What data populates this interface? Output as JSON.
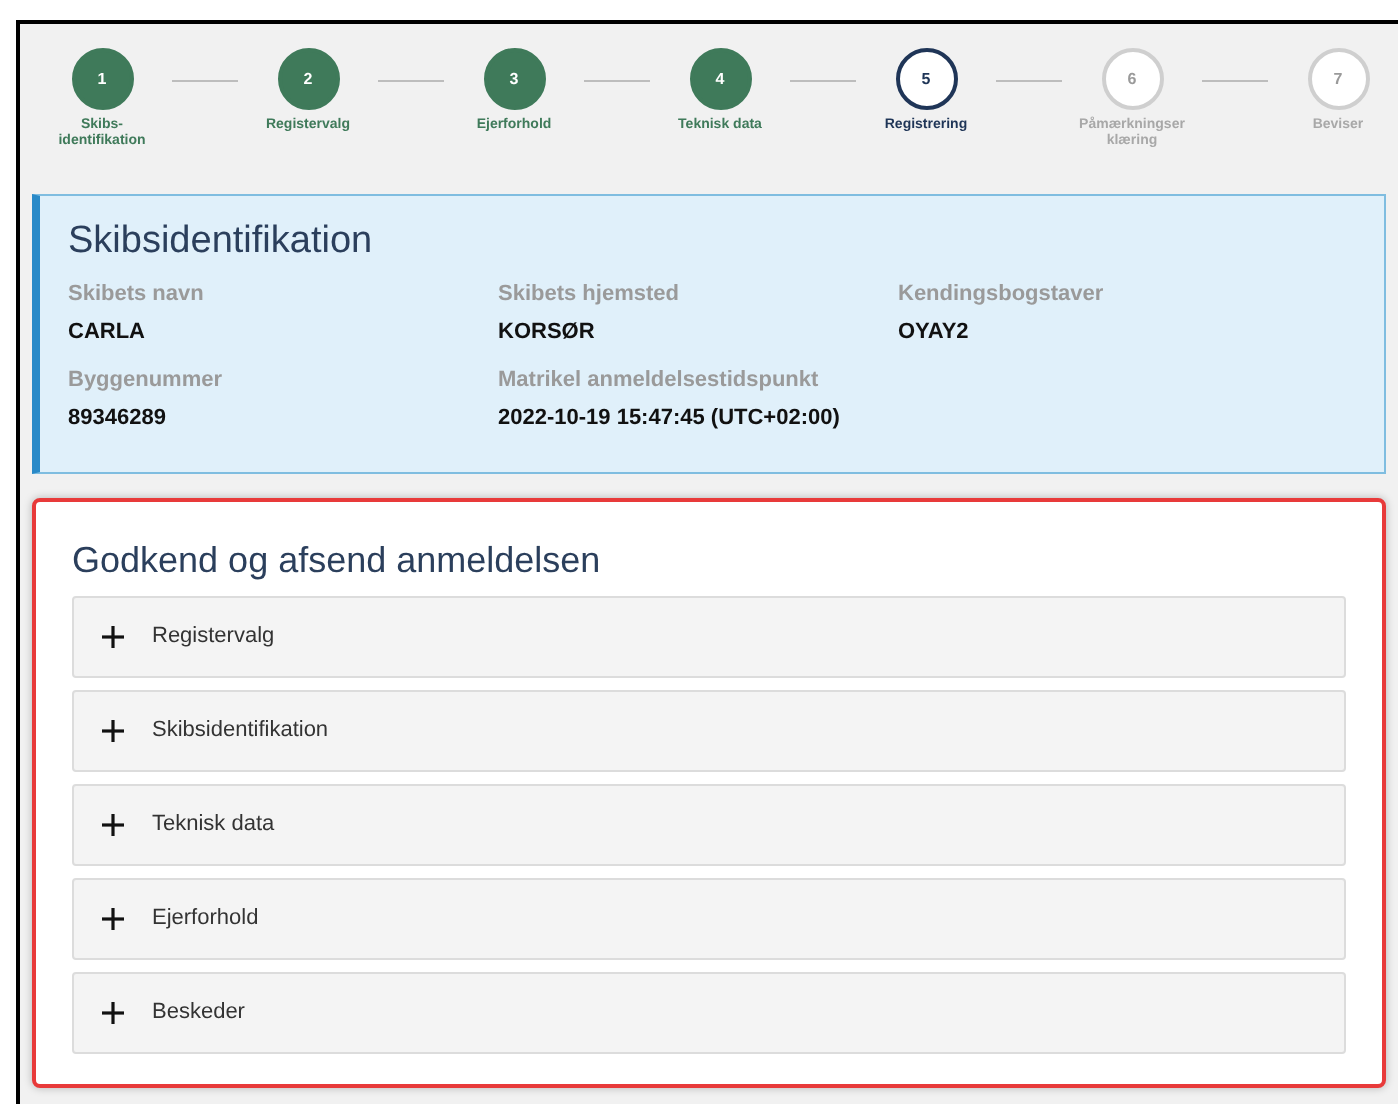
{
  "steps": [
    {
      "number": "1",
      "label": "Skibs-\nidentifikation",
      "kind": "done"
    },
    {
      "number": "2",
      "label": "Registervalg",
      "kind": "done"
    },
    {
      "number": "3",
      "label": "Ejerforhold",
      "kind": "done"
    },
    {
      "number": "4",
      "label": "Teknisk data",
      "kind": "done"
    },
    {
      "number": "5",
      "label": "Registrering",
      "kind": "current"
    },
    {
      "number": "6",
      "label": "Påmærkningser\nklæring",
      "kind": "todo"
    },
    {
      "number": "7",
      "label": "Beviser",
      "kind": "todo"
    }
  ],
  "ship_card": {
    "title": "Skibsidentifikation",
    "fields": [
      {
        "label": "Skibets navn",
        "value": "CARLA"
      },
      {
        "label": "Skibets hjemsted",
        "value": "KORSØR"
      },
      {
        "label": "Kendingsbogstaver",
        "value": "OYAY2"
      },
      {
        "label": "Byggenummer",
        "value": "89346289"
      },
      {
        "label": "Matrikel anmeldelsestidspunkt",
        "value": "2022-10-19 15:47:45 (UTC+02:00)"
      }
    ]
  },
  "approve_panel": {
    "title": "Godkend og afsend anmeldelsen",
    "sections": [
      {
        "label": "Registervalg",
        "expanded": false
      },
      {
        "label": "Skibsidentifikation",
        "expanded": false
      },
      {
        "label": "Teknisk data",
        "expanded": false
      },
      {
        "label": "Ejerforhold",
        "expanded": false
      },
      {
        "label": "Beskeder",
        "expanded": false
      }
    ]
  }
}
